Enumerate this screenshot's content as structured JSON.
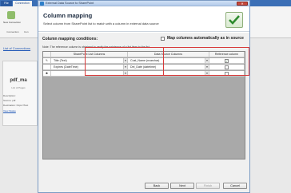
{
  "background": {
    "tabs": [
      "File",
      "Connection"
    ],
    "new_label": "New Connection",
    "conn_label": "Connection",
    "conn2_label": "Con",
    "link_text": "List of Connections",
    "panel_title": "pdf_ma",
    "panel_subtitle": "List of Pages",
    "panel_lines": [
      "Description:",
      "Source: pdf",
      "Destination: https://Test",
      "View Status"
    ]
  },
  "dialog": {
    "title": "External Data Source to SharePoint",
    "close_glyph": "✕",
    "header_title": "Column mapping",
    "header_desc": "Select column from SharePoint list to match with a column in external data source",
    "conditions_label": "Column mapping conditions:",
    "auto_map_label": "Map columns automatically as in source",
    "note": "Note: The reference column is obtained to verify the existence of a list item in the list",
    "columns": [
      "SharePoint List Columns",
      "Data Source Columns",
      "Reference column"
    ],
    "rows": [
      {
        "marker": "✎",
        "sp": "Title (Text)",
        "ds": "Cust_Name (nvarchar)",
        "ref": true
      },
      {
        "marker": "",
        "sp": "Expires (DateTime)",
        "ds": "Del_Date (datetime)",
        "ref": false
      },
      {
        "marker": "✱",
        "sp": "",
        "ds": "",
        "ref": false
      }
    ],
    "dropdown_glyph": "▼",
    "check_glyph": "✓",
    "buttons": {
      "back": "Back",
      "next": "Next",
      "finish": "Finish",
      "cancel": "Cancel"
    }
  }
}
